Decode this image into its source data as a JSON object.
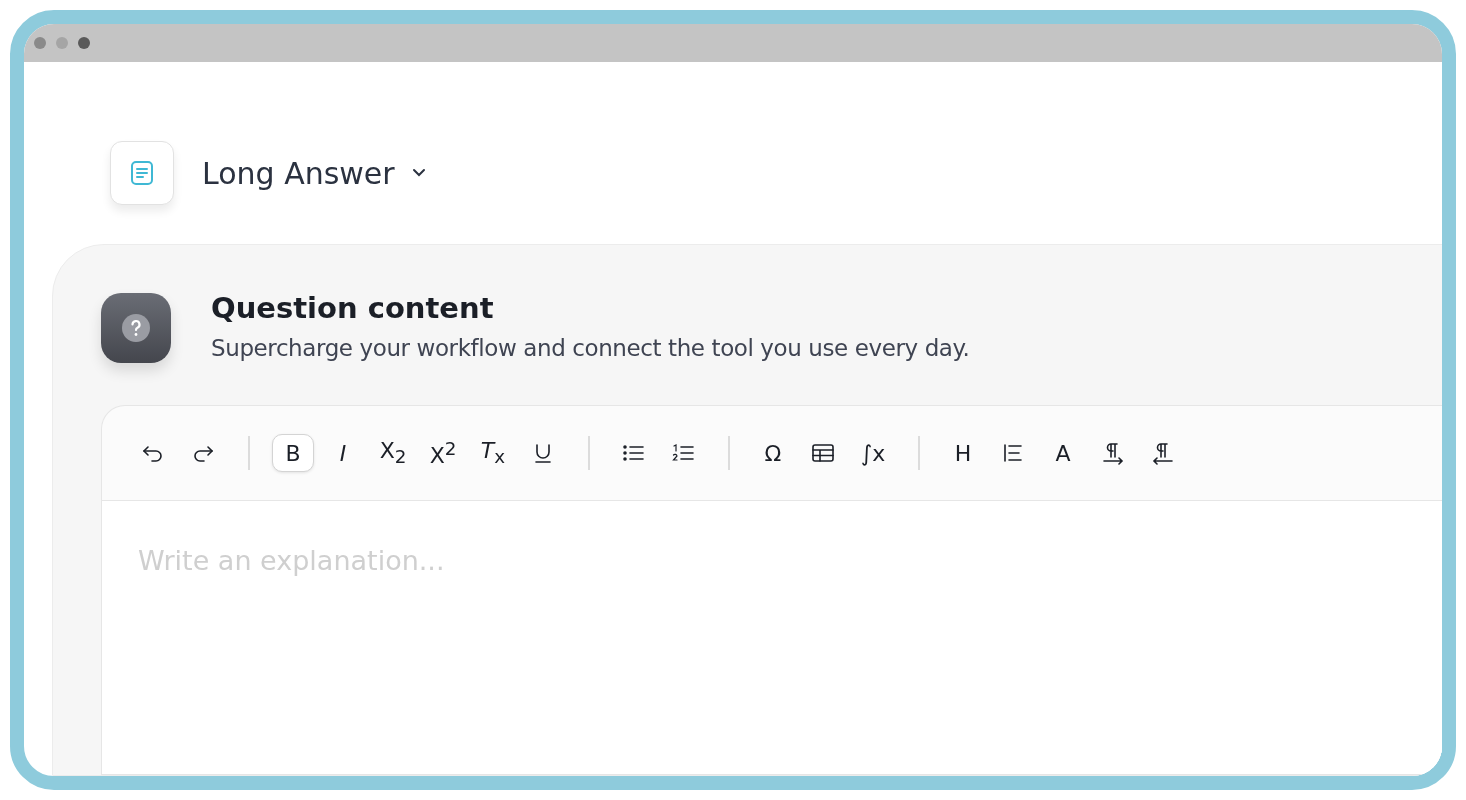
{
  "header": {
    "title": "Long Answer"
  },
  "section": {
    "title": "Question content",
    "subtitle": "Supercharge your workflow and connect the tool you use every day."
  },
  "toolbar": [
    [
      {
        "kind": "undo",
        "selected": false
      },
      {
        "kind": "redo",
        "selected": false
      }
    ],
    [
      {
        "kind": "text",
        "label": "B",
        "selected": true
      },
      {
        "kind": "text",
        "label": "*I*",
        "selected": false
      },
      {
        "kind": "text",
        "label": "X$_{2}$",
        "selected": false
      },
      {
        "kind": "text",
        "label": "X$^{2}$",
        "selected": false
      },
      {
        "kind": "text",
        "label": "*T*$_{x}$",
        "selected": false
      },
      {
        "kind": "underline",
        "selected": false
      }
    ],
    [
      {
        "kind": "bullets",
        "selected": false
      },
      {
        "kind": "numbered",
        "selected": false
      }
    ],
    [
      {
        "kind": "text",
        "label": "Ω",
        "selected": false
      },
      {
        "kind": "table",
        "selected": false
      },
      {
        "kind": "text",
        "label": "∫x",
        "selected": false
      }
    ],
    [
      {
        "kind": "text",
        "label": "H",
        "selected": false
      },
      {
        "kind": "align",
        "selected": false
      },
      {
        "kind": "text",
        "label": "A",
        "selected": false
      },
      {
        "kind": "ltr",
        "selected": false
      },
      {
        "kind": "rtl",
        "selected": false
      }
    ]
  ],
  "editor": {
    "placeholder": "Write an explanation..."
  }
}
